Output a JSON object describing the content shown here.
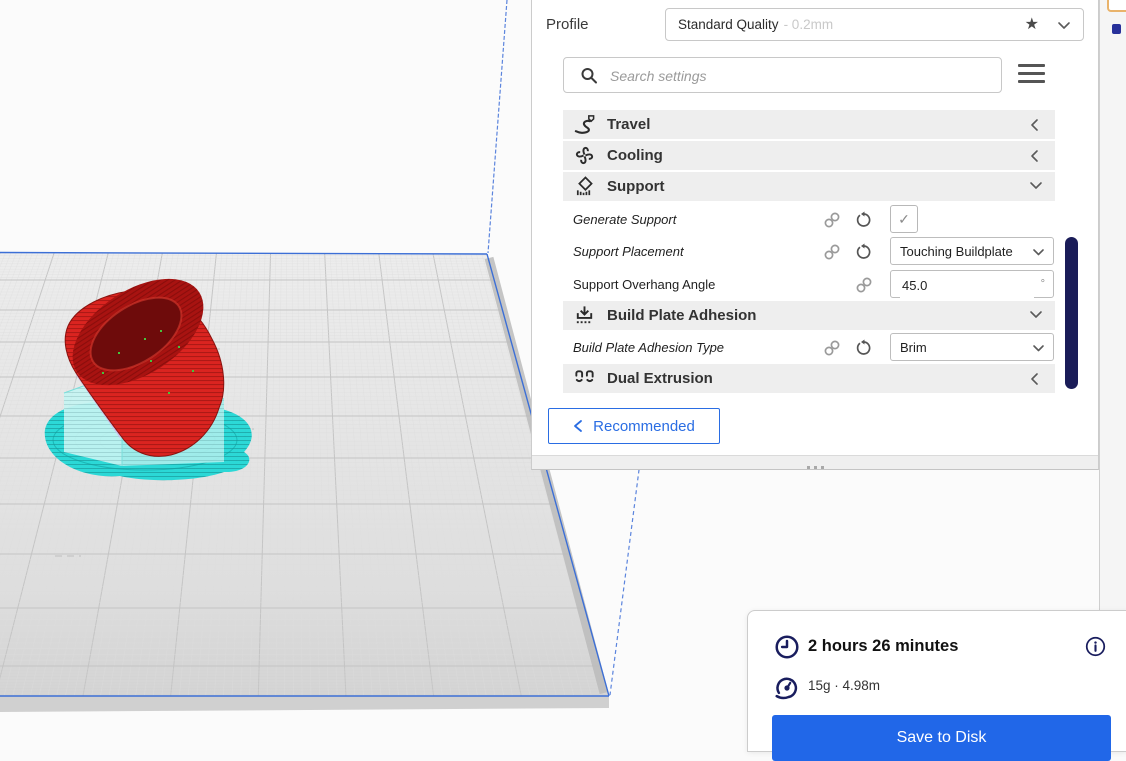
{
  "panel": {
    "profile_label": "Profile",
    "profile_value": "Standard Quality",
    "profile_suffix": "- 0.2mm",
    "star_glyph": "★",
    "search_placeholder": "Search settings",
    "rows": {
      "travel": {
        "label": "Travel"
      },
      "cooling": {
        "label": "Cooling"
      },
      "support": {
        "label": "Support"
      },
      "generate_support": {
        "label": "Generate Support",
        "check_glyph": "✓"
      },
      "support_placement": {
        "label": "Support Placement",
        "value": "Touching Buildplate"
      },
      "support_overhang_angle": {
        "label": "Support Overhang Angle",
        "value": "45.0",
        "unit": "°"
      },
      "build_plate_adhesion": {
        "label": "Build Plate Adhesion"
      },
      "build_plate_adhesion_type": {
        "label": "Build Plate Adhesion Type",
        "value": "Brim"
      },
      "dual_extrusion": {
        "label": "Dual Extrusion"
      }
    },
    "recommended_label": "Recommended"
  },
  "job_panel": {
    "print_time": "2 hours 26 minutes",
    "material_info": "15g · 4.98m",
    "save_button": "Save to Disk"
  },
  "icons": [
    "star-icon",
    "chevron-down-icon",
    "search-icon",
    "menu-icon",
    "travel-icon",
    "cooling-icon",
    "support-icon",
    "link-icon",
    "revert-icon",
    "build-plate-adhesion-icon",
    "dual-extrusion-icon",
    "clock-icon",
    "spool-icon",
    "info-icon"
  ],
  "colors": {
    "accent_blue": "#2a6de3",
    "save_button_blue": "#2167e8",
    "scrollbar_navy": "#1a1c58",
    "job_icon_navy": "#191d5e",
    "category_bg": "#eeeeee",
    "build_volume_blue": "#3c6fd6",
    "model_red": "#da2420",
    "support_cyan": "#25d8d6"
  }
}
